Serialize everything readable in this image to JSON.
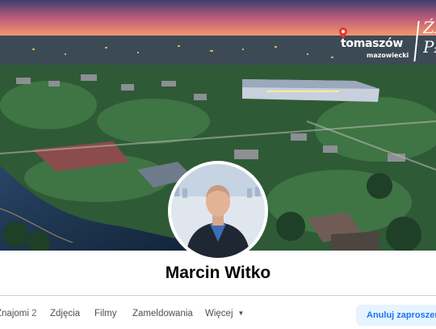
{
  "cover": {
    "brand_name": "tomaszów",
    "brand_sub": "mazowiecki",
    "brand_tag": "ŹR PŁ"
  },
  "profile": {
    "name": "Marcin Witko"
  },
  "tabs": [
    {
      "label": "Znajomi",
      "count": "2"
    },
    {
      "label": "Zdjęcia"
    },
    {
      "label": "Filmy"
    },
    {
      "label": "Zameldowania"
    },
    {
      "label": "Więcej"
    }
  ],
  "actions": {
    "cancel_invite_label": "Anuluj zaproszenie"
  },
  "colors": {
    "accent": "#1877f2",
    "accent_bg": "#e7f3ff"
  }
}
